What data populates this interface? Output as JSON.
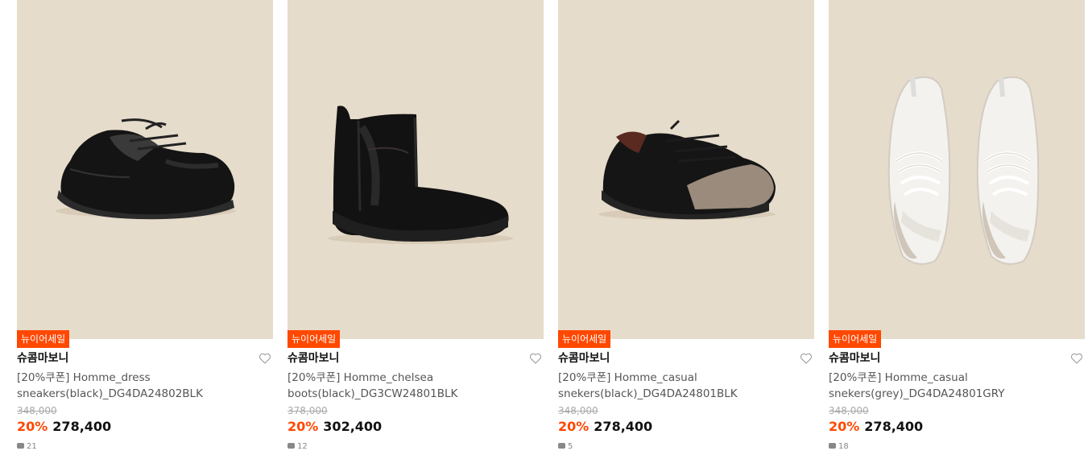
{
  "products": [
    {
      "badge": "뉴이어세일",
      "brand": "슈콤마보니",
      "name": "[20%쿠폰] Homme_dress sneakers(black)_DG4DA24802BLK",
      "original_price": "348,000",
      "discount": "20%",
      "price": "278,400",
      "reviews": "21",
      "image_icon": "black-dress-sneaker"
    },
    {
      "badge": "뉴이어세일",
      "brand": "슈콤마보니",
      "name": "[20%쿠폰] Homme_chelsea boots(black)_DG3CW24801BLK",
      "original_price": "378,000",
      "discount": "20%",
      "price": "302,400",
      "reviews": "12",
      "image_icon": "black-chelsea-boot"
    },
    {
      "badge": "뉴이어세일",
      "brand": "슈콤마보니",
      "name": "[20%쿠폰] Homme_casual snekers(black)_DG4DA24801BLK",
      "original_price": "348,000",
      "discount": "20%",
      "price": "278,400",
      "reviews": "5",
      "image_icon": "black-casual-sneaker"
    },
    {
      "badge": "뉴이어세일",
      "brand": "슈콤마보니",
      "name": "[20%쿠폰] Homme_casual snekers(grey)_DG4DA24801GRY",
      "original_price": "348,000",
      "discount": "20%",
      "price": "278,400",
      "reviews": "18",
      "image_icon": "white-grey-sneaker-pair"
    }
  ],
  "colors": {
    "image_bg": "#e6dccb",
    "accent": "#ff4800"
  }
}
